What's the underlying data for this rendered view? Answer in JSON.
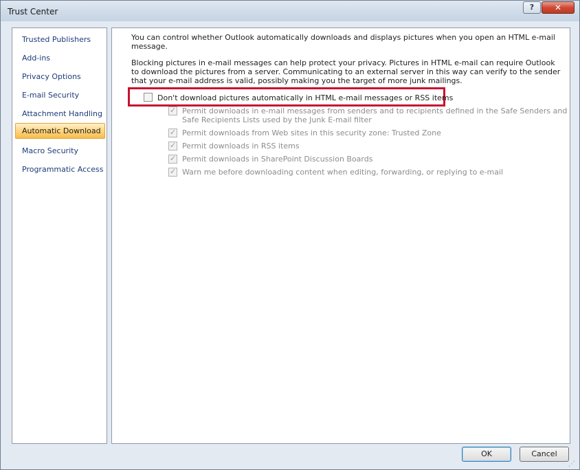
{
  "window": {
    "title": "Trust Center",
    "help_label": "?",
    "close_label": "✕"
  },
  "sidebar": {
    "items": [
      {
        "label": "Trusted Publishers"
      },
      {
        "label": "Add-ins"
      },
      {
        "label": "Privacy Options"
      },
      {
        "label": "E-mail Security"
      },
      {
        "label": "Attachment Handling"
      },
      {
        "label": "Automatic Download",
        "selected": true
      },
      {
        "label": "Macro Security"
      },
      {
        "label": "Programmatic Access"
      }
    ]
  },
  "content": {
    "intro": "You can control whether Outlook automatically downloads and displays pictures when you open an HTML e-mail message.",
    "privacy": "Blocking pictures in e-mail messages can help protect your privacy. Pictures in HTML e-mail can require Outlook to download the pictures from a server. Communicating to an external server in this way can verify to the sender that your e-mail address is valid, possibly making you the target of more junk mailings.",
    "main_option": {
      "label": "Don't download pictures automatically in HTML e-mail messages or RSS items",
      "checked": false
    },
    "sub_options": [
      {
        "label_line1": "Permit downloads in e-mail messages from senders and to recipients defined in the Safe Senders and",
        "label_line2": "Safe Recipients Lists used by the Junk E-mail filter",
        "checked": true
      },
      {
        "label": "Permit downloads from Web sites in this security zone: Trusted Zone",
        "checked": true
      },
      {
        "label": "Permit downloads in RSS items",
        "checked": true
      },
      {
        "label": "Permit downloads in SharePoint Discussion Boards",
        "checked": true
      },
      {
        "label": "Warn me before downloading content when editing, forwarding, or replying to e-mail",
        "checked": true
      }
    ]
  },
  "buttons": {
    "ok_label": "OK",
    "cancel_label": "Cancel"
  },
  "colors": {
    "highlight": "#c8102e",
    "selected_nav": "#ffd37a",
    "link_text": "#1c3b78"
  }
}
